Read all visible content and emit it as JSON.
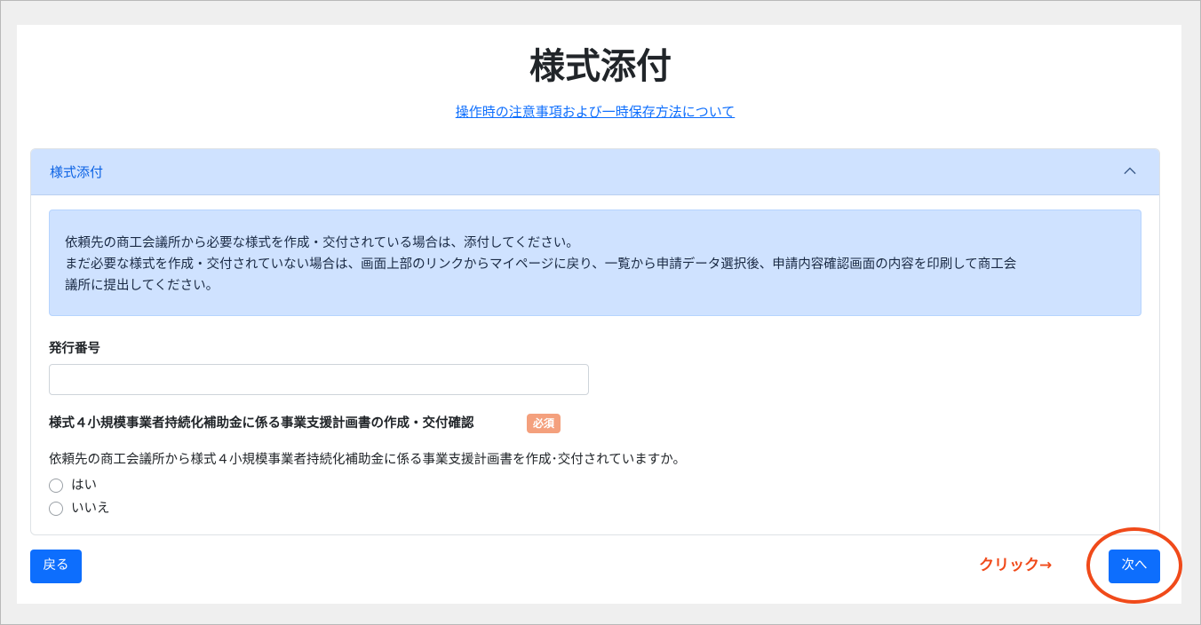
{
  "page": {
    "title": "様式添付",
    "notice_link": "操作時の注意事項および一時保存方法について"
  },
  "accordion": {
    "header_label": "様式添付",
    "header_icon": "chevron-up-icon",
    "info_lines": [
      "依頼先の商工会議所から必要な様式を作成・交付されている場合は、添付してください。",
      "まだ必要な様式を作成・交付されていない場合は、画面上部のリンクからマイページに戻り、一覧から申請データ選択後、申請内容確認画面の内容を印刷して商工会",
      "議所に提出してください。"
    ],
    "issue_number": {
      "label": "発行番号",
      "value": ""
    },
    "confirmation": {
      "label": "様式４小規模事業者持続化補助金に係る事業支援計画書の作成・交付確認",
      "required_badge": "必須",
      "question": "依頼先の商工会議所から様式４小規模事業者持続化補助金に係る事業支援計画書を作成･交付されていますか。",
      "options": [
        "はい",
        "いいえ"
      ],
      "selected": null
    }
  },
  "footer": {
    "back_label": "戻る",
    "next_label": "次へ"
  },
  "annotation": {
    "text": "クリック→",
    "color": "#f04a1a"
  },
  "colors": {
    "primary": "#0d6efd",
    "accordion_header_bg": "#cfe2ff",
    "badge_bg": "#f4a07d"
  }
}
